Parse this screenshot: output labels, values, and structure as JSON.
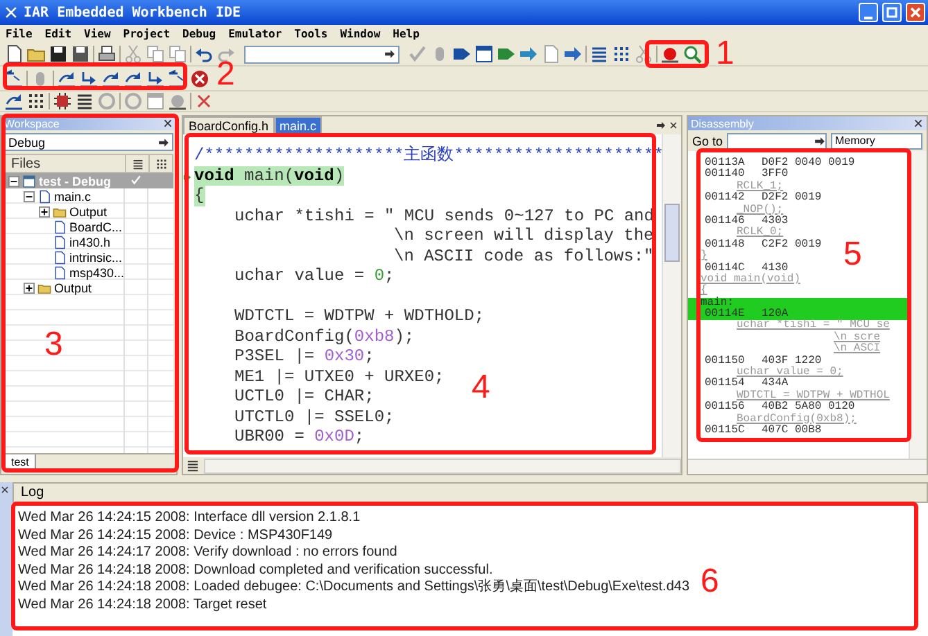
{
  "window": {
    "title": "IAR Embedded Workbench IDE"
  },
  "menu": [
    "File",
    "Edit",
    "View",
    "Project",
    "Debug",
    "Emulator",
    "Tools",
    "Window",
    "Help"
  ],
  "workspace": {
    "title": "Workspace",
    "configuration": "Debug",
    "column": "Files",
    "tree": [
      {
        "label": "test - Debug",
        "kind": "project",
        "selected": true,
        "expanded": true,
        "children": [
          {
            "label": "main.c",
            "kind": "file",
            "selected": false,
            "expanded": true,
            "children": [
              {
                "label": "Output",
                "kind": "folder",
                "selected": false,
                "expanded": false
              },
              {
                "label": "BoardC...",
                "kind": "file",
                "selected": false
              },
              {
                "label": "in430.h",
                "kind": "file",
                "selected": false
              },
              {
                "label": "intrinsic...",
                "kind": "file",
                "selected": false
              },
              {
                "label": "msp430...",
                "kind": "file",
                "selected": false
              }
            ]
          },
          {
            "label": "Output",
            "kind": "folder",
            "selected": false,
            "expanded": false
          }
        ]
      }
    ],
    "tabs": [
      {
        "label": "test",
        "selected": true
      }
    ]
  },
  "editor": {
    "tabs": [
      {
        "label": "BoardConfig.h",
        "selected": false
      },
      {
        "label": "main.c",
        "selected": true
      }
    ],
    "lines": [
      {
        "kind": "top",
        "highlighted": false,
        "segments": [
          {
            "kind": "comment",
            "text": "/********************主函数*********************"
          }
        ]
      },
      {
        "kind": "top",
        "highlighted": true,
        "segments": [
          {
            "kind": "keyword",
            "text": "void"
          },
          {
            "kind": "plain",
            "text": " main("
          },
          {
            "kind": "keyword",
            "text": "void"
          },
          {
            "kind": "plain",
            "text": ")"
          }
        ]
      },
      {
        "kind": "top",
        "highlighted": true,
        "segments": [
          {
            "kind": "plain",
            "text": "{"
          }
        ]
      },
      {
        "kind": "body",
        "highlighted": false,
        "segments": [
          {
            "kind": "plain",
            "text": "uchar *tishi = \" MCU sends 0~127 to PC and"
          }
        ]
      },
      {
        "kind": "continuation",
        "highlighted": false,
        "segments": [
          {
            "kind": "plain",
            "text": "\\n screen will display the"
          }
        ]
      },
      {
        "kind": "continuation",
        "highlighted": false,
        "segments": [
          {
            "kind": "plain",
            "text": "\\n ASCII code as follows:\""
          }
        ]
      },
      {
        "kind": "body",
        "highlighted": false,
        "segments": [
          {
            "kind": "plain",
            "text": "uchar value = "
          },
          {
            "kind": "number",
            "text": "0"
          },
          {
            "kind": "plain",
            "text": ";"
          }
        ]
      },
      {
        "kind": "blank"
      },
      {
        "kind": "body",
        "highlighted": false,
        "segments": [
          {
            "kind": "plain",
            "text": "WDTCTL = WDTPW + WDTHOLD;"
          }
        ]
      },
      {
        "kind": "body",
        "highlighted": false,
        "segments": [
          {
            "kind": "plain",
            "text": "BoardConfig("
          },
          {
            "kind": "hex",
            "text": "0xb8"
          },
          {
            "kind": "plain",
            "text": ");"
          }
        ]
      },
      {
        "kind": "body",
        "highlighted": false,
        "segments": [
          {
            "kind": "plain",
            "text": "P3SEL |= "
          },
          {
            "kind": "hex",
            "text": "0x30"
          },
          {
            "kind": "plain",
            "text": ";"
          }
        ]
      },
      {
        "kind": "body",
        "highlighted": false,
        "segments": [
          {
            "kind": "plain",
            "text": "ME1 |= UTXE0 + URXE0;"
          }
        ]
      },
      {
        "kind": "body",
        "highlighted": false,
        "segments": [
          {
            "kind": "plain",
            "text": "UCTL0 |= CHAR;"
          }
        ]
      },
      {
        "kind": "body",
        "highlighted": false,
        "segments": [
          {
            "kind": "plain",
            "text": "UTCTL0 |= SSEL0;"
          }
        ]
      },
      {
        "kind": "body",
        "highlighted": false,
        "segments": [
          {
            "kind": "plain",
            "text": "UBR00 = "
          },
          {
            "kind": "hex",
            "text": "0x0D"
          },
          {
            "kind": "plain",
            "text": ";"
          }
        ]
      }
    ]
  },
  "disassembly": {
    "title": "Disassembly",
    "goto_label": "Go to",
    "memory_button": "Memory",
    "lines": [
      {
        "kind": "code",
        "address": "00113A",
        "code": "D0F2 0040 0019",
        "current": false
      },
      {
        "kind": "code",
        "address": "001140",
        "code": "3FF0",
        "current": false
      },
      {
        "kind": "statement",
        "text": "RCLK_1;",
        "current": false
      },
      {
        "kind": "code",
        "address": "001142",
        "code": "D2F2 0019",
        "current": false
      },
      {
        "kind": "statement",
        "text": "_NOP();",
        "current": false
      },
      {
        "kind": "code",
        "address": "001146",
        "code": "4303",
        "current": false
      },
      {
        "kind": "statement",
        "text": "RCLK_0;",
        "current": false
      },
      {
        "kind": "code",
        "address": "001148",
        "code": "C2F2 0019",
        "current": false
      },
      {
        "kind": "source",
        "text": "}",
        "current": false
      },
      {
        "kind": "code",
        "address": "00114C",
        "code": "4130",
        "current": false
      },
      {
        "kind": "source",
        "text": "void main(void)",
        "current": false
      },
      {
        "kind": "source",
        "text": "{",
        "current": false
      },
      {
        "kind": "label",
        "text": "main:",
        "current": true
      },
      {
        "kind": "code",
        "address": "00114E",
        "code": "120A",
        "current": true
      },
      {
        "kind": "statement",
        "text": "uchar *tishi = \" MCU se",
        "current": false
      },
      {
        "kind": "continuation",
        "text": "\\n scre",
        "current": false
      },
      {
        "kind": "continuation",
        "text": "\\n ASCI",
        "current": false
      },
      {
        "kind": "code",
        "address": "001150",
        "code": "403F 1220",
        "current": false
      },
      {
        "kind": "statement",
        "text": "uchar value = 0;",
        "current": false
      },
      {
        "kind": "code",
        "address": "001154",
        "code": "434A",
        "current": false
      },
      {
        "kind": "statement",
        "text": "WDTCTL = WDTPW + WDTHOL",
        "current": false
      },
      {
        "kind": "code",
        "address": "001156",
        "code": "40B2 5A80 0120",
        "current": false
      },
      {
        "kind": "statement",
        "text": "BoardConfig(0xb8);",
        "current": false
      },
      {
        "kind": "code",
        "address": "00115C",
        "code": "407C 00B8",
        "current": false
      }
    ]
  },
  "log": {
    "tab": "Log",
    "lines": [
      "Wed Mar 26 14:24:15 2008: Interface dll version 2.1.8.1",
      "Wed Mar 26 14:24:15 2008: Device : MSP430F149",
      "Wed Mar 26 14:24:17 2008: Verify download : no errors found",
      "Wed Mar 26 14:24:18 2008: Download completed and verification successful.",
      "Wed Mar 26 14:24:18 2008: Loaded debugee: C:\\Documents and Settings\\张勇\\桌面\\test\\Debug\\Exe\\test.d43",
      "Wed Mar 26 14:24:18 2008: Target reset"
    ]
  },
  "annotations": [
    {
      "label": "1"
    },
    {
      "label": "2"
    },
    {
      "label": "3"
    },
    {
      "label": "4"
    },
    {
      "label": "5"
    },
    {
      "label": "6"
    }
  ]
}
